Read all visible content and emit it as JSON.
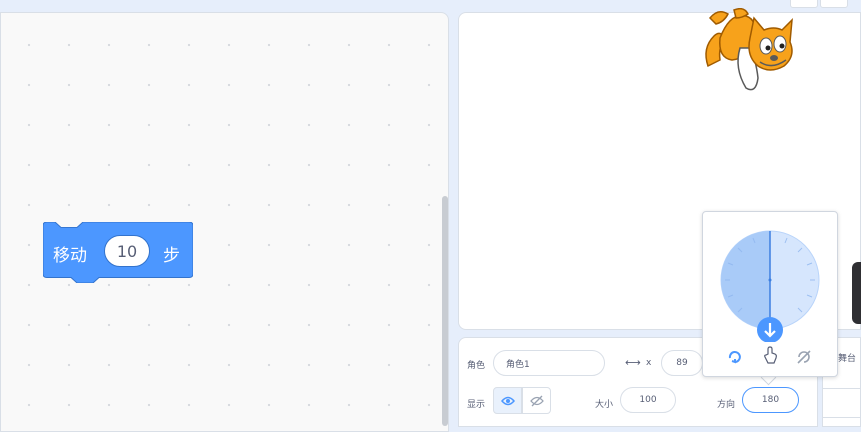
{
  "code_block": {
    "label_left": "移动",
    "value": "10",
    "label_right": "步",
    "color": "#4c97ff"
  },
  "sprite_info": {
    "sprite_label": "角色",
    "sprite_name": "角色1",
    "x_label": "x",
    "x_value": "89",
    "show_label": "显示",
    "size_label": "大小",
    "size_value": "100",
    "direction_label": "方向",
    "direction_value": "180"
  },
  "stage_panel": {
    "label": "舞台"
  },
  "direction_popover": {
    "direction_degrees": 180,
    "rotation_modes": [
      "all-around-icon",
      "dont-rotate-icon",
      "left-right-icon"
    ]
  },
  "colors": {
    "accent": "#4c97ff",
    "dial_fill": "#a9cbf8",
    "background": "#e6eefb"
  }
}
